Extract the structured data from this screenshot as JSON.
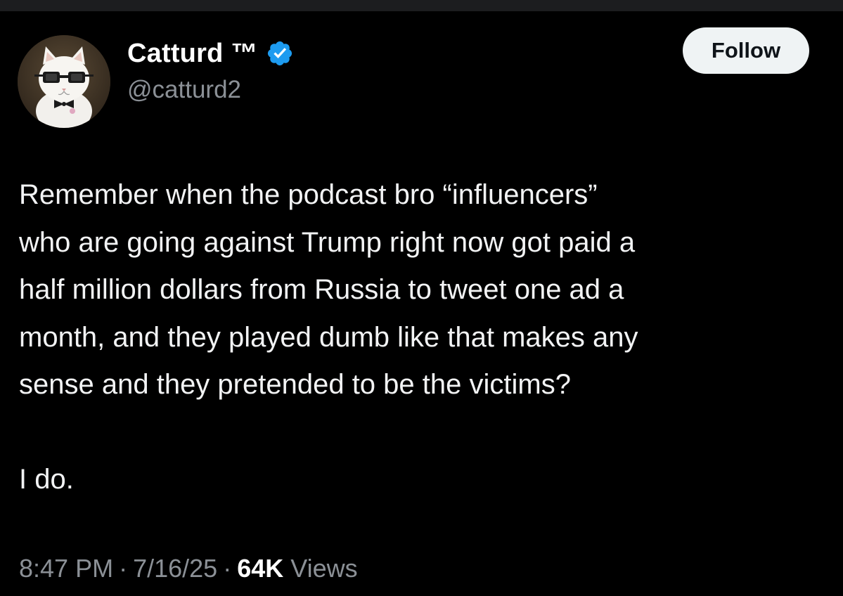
{
  "author": {
    "display_name": "Catturd ™",
    "handle": "@catturd2",
    "verified": true,
    "verified_color": "#1d9bf0",
    "avatar": "cat-with-glasses-avatar"
  },
  "follow_button": {
    "label": "Follow"
  },
  "tweet": {
    "lines": [
      "Remember when the podcast bro “influencers”",
      "who are going against Trump right now got paid a",
      "half million dollars from Russia to tweet one ad a",
      "month, and they played dumb like that makes any",
      "sense and they pretended to be the victims?"
    ],
    "closing": "I do."
  },
  "meta": {
    "time": "8:47 PM",
    "separator": "·",
    "date": "7/16/25",
    "views_count": "64K",
    "views_label": "Views"
  },
  "colors": {
    "background": "#000000",
    "text": "#e7e9ea",
    "secondary_text": "#8b9096",
    "follow_bg": "#eff3f4"
  }
}
